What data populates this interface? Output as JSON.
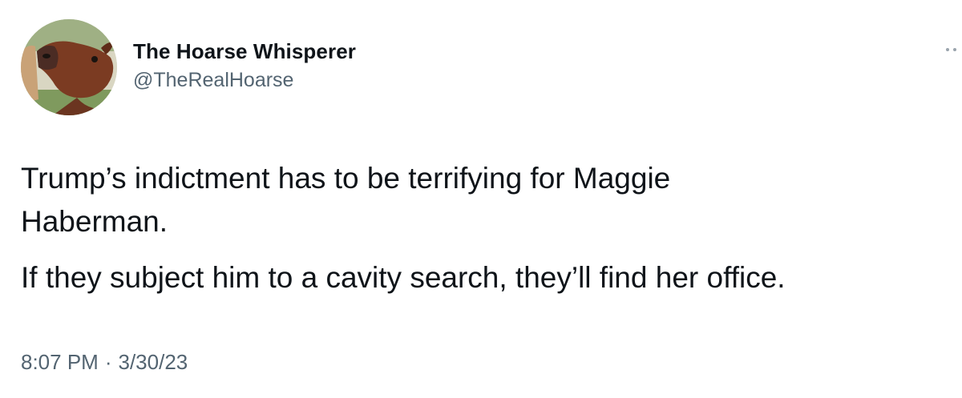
{
  "author": {
    "display_name": "The Hoarse Whisperer",
    "handle": "@TheRealHoarse",
    "avatar_icon": "horse-avatar-icon"
  },
  "tweet": {
    "paragraphs": [
      "Trump’s indictment has to be terrifying for Maggie\nHaberman.",
      "If they subject him to a cavity search, they’ll find her office."
    ],
    "time": "8:07 PM",
    "separator": "·",
    "date": "3/30/23"
  },
  "menu": {
    "icon": "more-options-icon"
  },
  "colors": {
    "text": "#0f1419",
    "secondary": "#536471"
  }
}
